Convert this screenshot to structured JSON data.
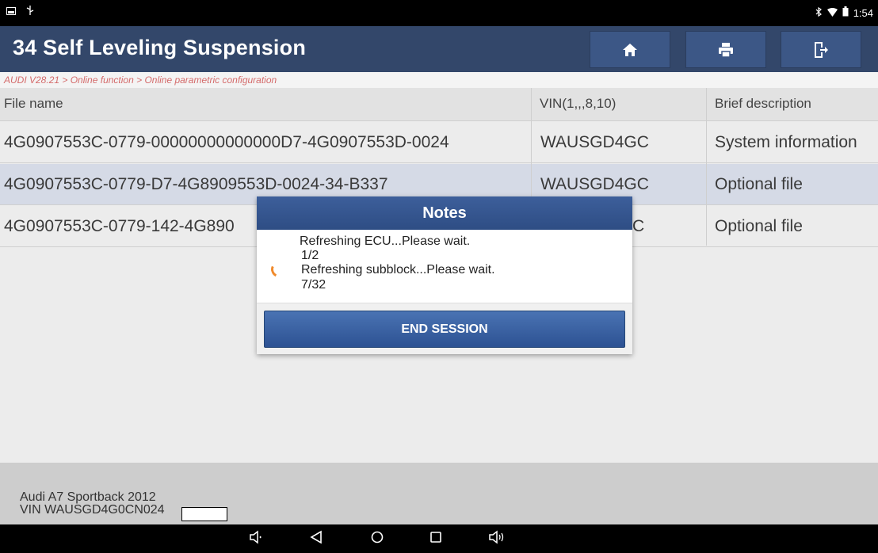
{
  "status_bar": {
    "time": "1:54",
    "icons": [
      "image-icon",
      "usb-icon",
      "bluetooth-icon",
      "wifi-icon",
      "battery-icon"
    ]
  },
  "header": {
    "title": "34 Self Leveling Suspension",
    "buttons": [
      "home-icon",
      "print-icon",
      "exit-icon"
    ]
  },
  "breadcrumb": "AUDI V28.21 > Online function > Online parametric configuration",
  "table": {
    "columns": [
      "File name",
      "VIN(1,,,8,10)",
      "Brief description"
    ],
    "rows": [
      [
        "4G0907553C-0779-00000000000000D7-4G0907553D-0024",
        "WAUSGD4GC",
        "System information"
      ],
      [
        "4G0907553C-0779-D7-4G8909553D-0024-34-B337",
        "WAUSGD4GC",
        "Optional file"
      ],
      [
        "4G0907553C-0779-142-4G890",
        "C",
        "Optional file"
      ]
    ],
    "selected_row": 1
  },
  "footer": {
    "vehicle": "Audi A7 Sportback 2012",
    "vin": "VIN WAUSGD4G0CN024"
  },
  "dialog": {
    "title": "Notes",
    "lines": [
      "Refreshing ECU...Please wait.",
      "1/2",
      "Refreshing subblock...Please wait.",
      "7/32"
    ],
    "button": "END SESSION"
  },
  "colors": {
    "title_bar": "#33476a",
    "accent": "#2e4d84",
    "spinner": "#f08a2c",
    "breadcrumb_text": "#d46b6b"
  }
}
